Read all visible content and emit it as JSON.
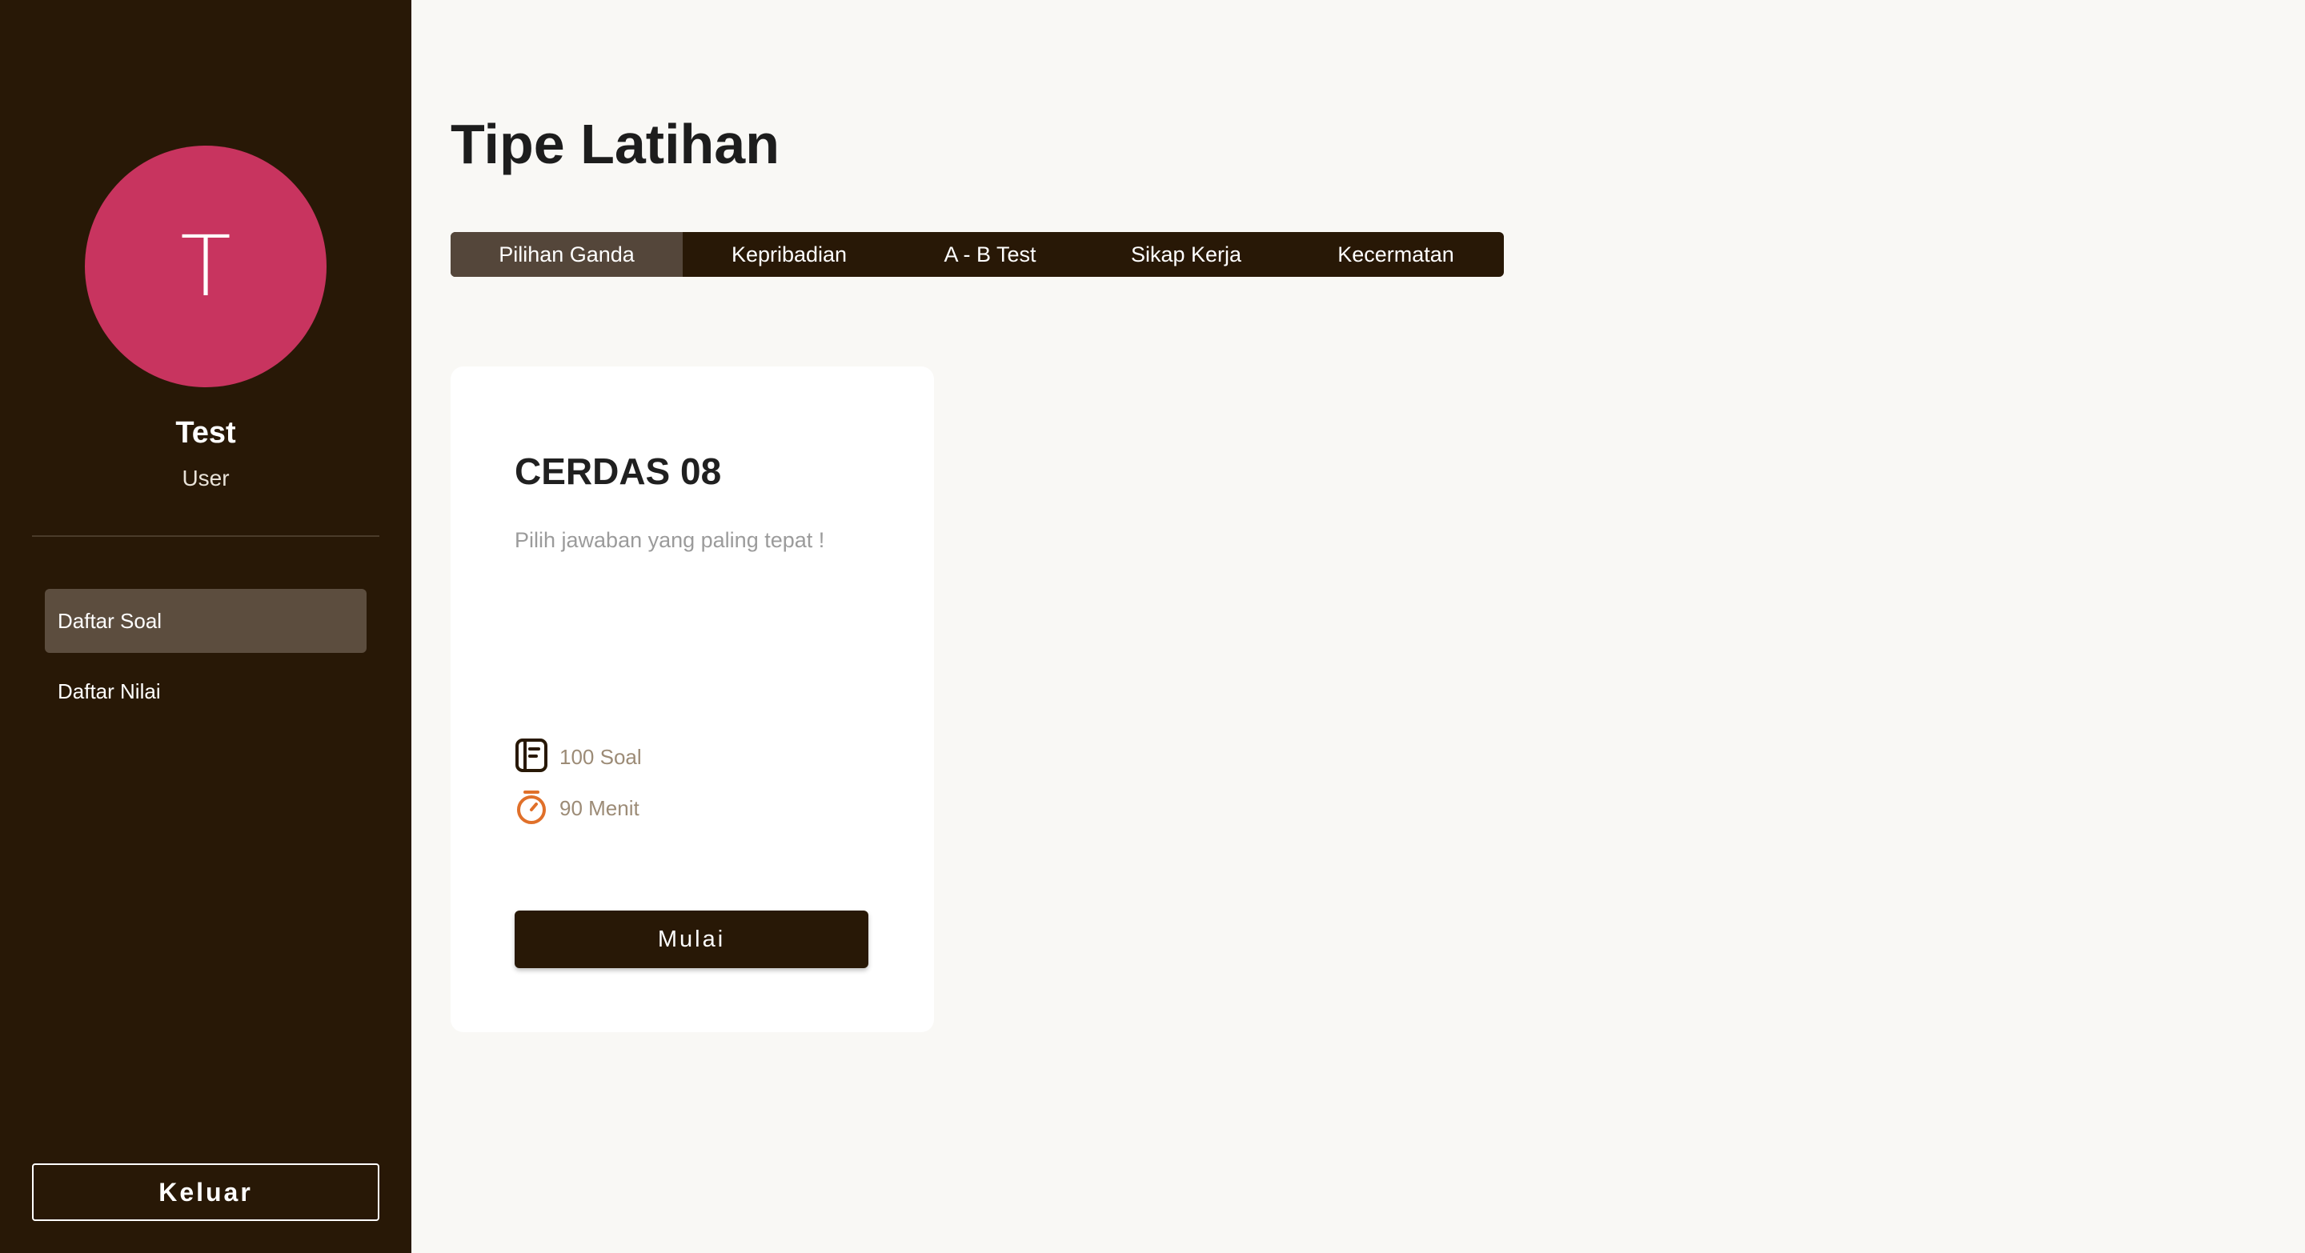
{
  "sidebar": {
    "avatar_initial": "T",
    "user_name": "Test",
    "user_role": "User",
    "nav": [
      {
        "label": "Daftar Soal",
        "active": true
      },
      {
        "label": "Daftar Nilai",
        "active": false
      }
    ],
    "logout_label": "Keluar"
  },
  "main": {
    "title": "Tipe Latihan",
    "tabs": [
      {
        "label": "Pilihan Ganda",
        "active": true
      },
      {
        "label": "Kepribadian",
        "active": false
      },
      {
        "label": "A - B Test",
        "active": false
      },
      {
        "label": "Sikap Kerja",
        "active": false
      },
      {
        "label": "Kecermatan",
        "active": false
      }
    ],
    "card": {
      "title": "CERDAS 08",
      "description": "Pilih jawaban yang paling tepat !",
      "questions": "100 Soal",
      "duration": "90 Menit",
      "questions_icon": "notebook-icon",
      "duration_icon": "stopwatch-icon",
      "start_label": "Mulai"
    }
  },
  "colors": {
    "sidebar_bg": "#281806",
    "avatar_bg": "#c8345f",
    "active_item": "#5c4d3e",
    "active_tab": "#54463a",
    "page_bg": "#f9f8f5",
    "timer_accent": "#e0702a"
  }
}
